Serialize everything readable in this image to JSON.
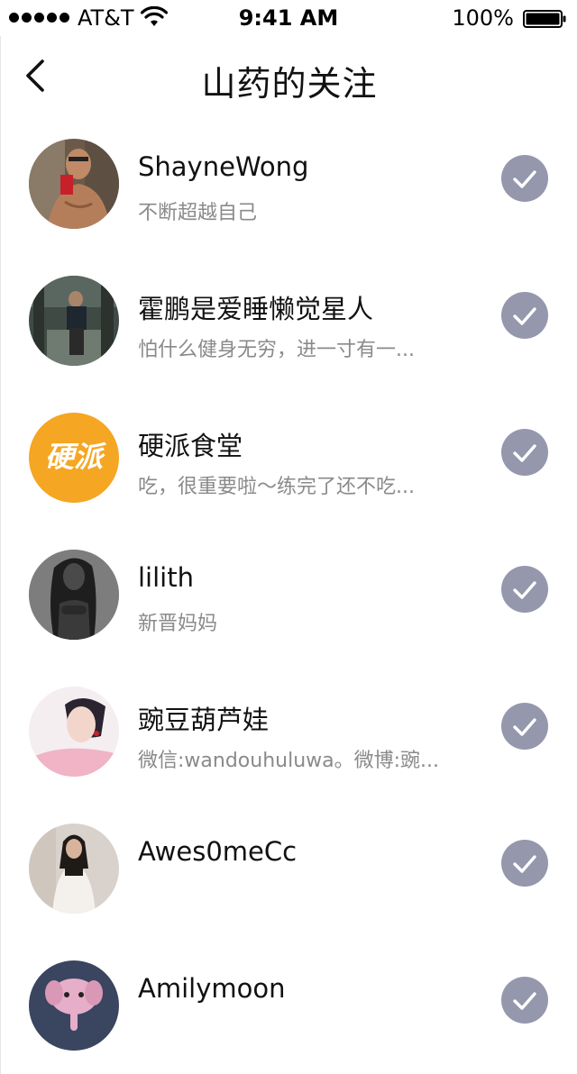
{
  "status_bar": {
    "carrier": "AT&T",
    "time": "9:41 AM",
    "battery": "100%"
  },
  "nav": {
    "title": "山药的关注",
    "back_icon": "chevron-left-icon"
  },
  "colors": {
    "check_button": "#9597ad",
    "brand_orange": "#f5a623",
    "subtitle_gray": "#8a8a8a"
  },
  "following": [
    {
      "name": "ShayneWong",
      "bio": "不断超越自己",
      "followed": true
    },
    {
      "name": "霍鹏是爱睡懒觉星人",
      "bio": "怕什么健身无穷，进一寸有一...",
      "followed": true
    },
    {
      "name": "硬派食堂",
      "bio": "吃，很重要啦～练完了还不吃...",
      "followed": true,
      "avatar_text": "硬派"
    },
    {
      "name": "lilith",
      "bio": "新晋妈妈",
      "followed": true
    },
    {
      "name": "豌豆葫芦娃",
      "bio": "微信:wandouhuluwa。微博:豌...",
      "followed": true
    },
    {
      "name": "Awes0meCc",
      "bio": "",
      "followed": true
    },
    {
      "name": "Amilymoon",
      "bio": "",
      "followed": true
    }
  ]
}
